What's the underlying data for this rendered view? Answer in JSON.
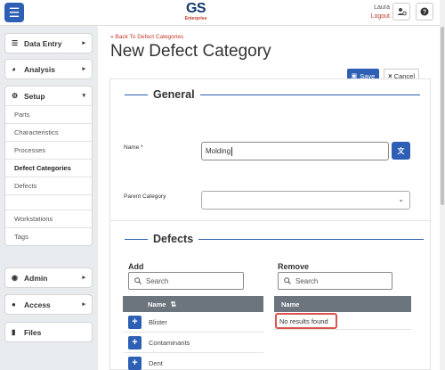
{
  "header": {
    "brand": "GS",
    "brand_sub": "Enterprise",
    "user_name": "Laura",
    "logout_label": "Logout"
  },
  "sidebar": {
    "data_entry": "Data Entry",
    "analysis": "Analysis",
    "setup": "Setup",
    "setup_items": [
      "Parts",
      "Characteristics",
      "Processes",
      "Defect Categories",
      "Defects",
      "Workstations",
      "Tags"
    ],
    "admin": "Admin",
    "access": "Access",
    "files": "Files"
  },
  "page": {
    "back_link": "« Back To Defect Categories",
    "title": "New Defect Category",
    "save_label": "Save",
    "cancel_label": "Cancel"
  },
  "general": {
    "section_title": "General",
    "name_label": "Name *",
    "name_value": "Molding",
    "parent_label": "Parent Category",
    "parent_value": ""
  },
  "defects": {
    "section_title": "Defects",
    "add_title": "Add",
    "remove_title": "Remove",
    "search_placeholder": "Search",
    "name_header": "Name",
    "add_items": [
      "Blister",
      "Contaminants",
      "Dent"
    ],
    "no_results": "No results found"
  },
  "colors": {
    "accent": "#2d5fb5",
    "logout": "#c0392b",
    "table_header": "#6c757d",
    "highlight": "#d9534f"
  }
}
